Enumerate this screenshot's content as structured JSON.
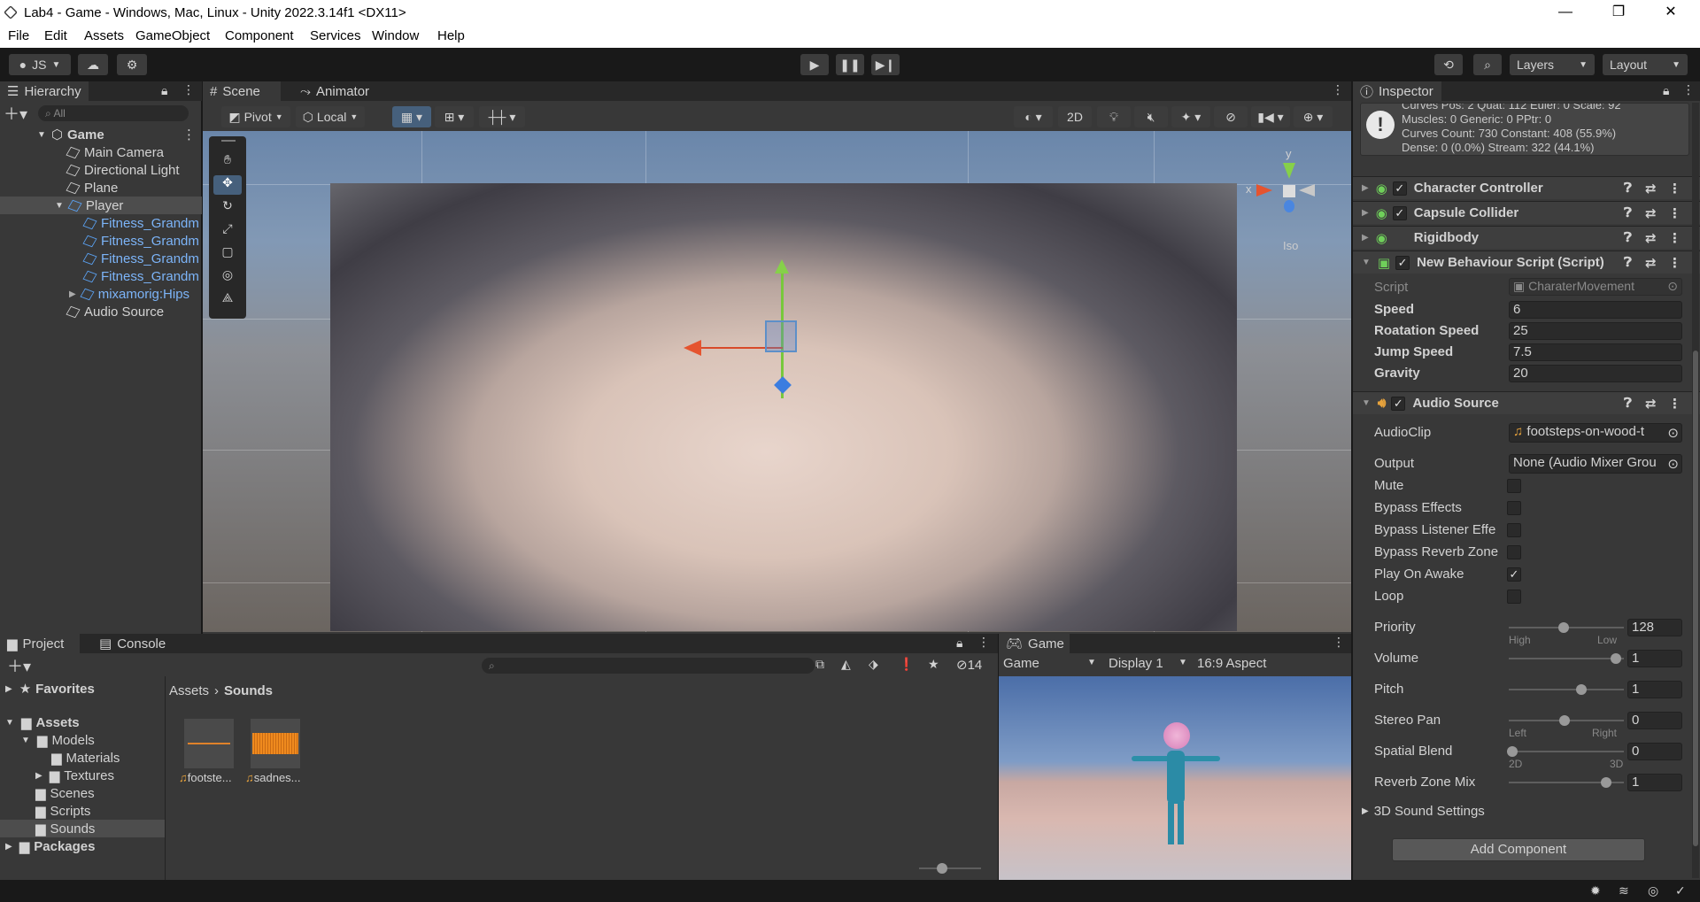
{
  "window": {
    "title": "Lab4 - Game - Windows, Mac, Linux - Unity 2022.3.14f1 <DX11>",
    "controls": [
      "—",
      "❐",
      "✕"
    ]
  },
  "menu": [
    "File",
    "Edit",
    "Assets",
    "GameObject",
    "Component",
    "Services",
    "Window",
    "Help"
  ],
  "toolbar": {
    "account": "JS",
    "layers": "Layers",
    "layout": "Layout"
  },
  "hierarchy": {
    "tab": "Hierarchy",
    "search_placeholder": "All",
    "root": "Game",
    "items": [
      {
        "label": "Main Camera"
      },
      {
        "label": "Directional Light"
      },
      {
        "label": "Plane"
      },
      {
        "label": "Player"
      },
      {
        "label": "Fitness_Grandm"
      },
      {
        "label": "Fitness_Grandm"
      },
      {
        "label": "Fitness_Grandm"
      },
      {
        "label": "Fitness_Grandm"
      },
      {
        "label": "mixamorig:Hips"
      },
      {
        "label": "Audio Source"
      }
    ]
  },
  "scene": {
    "tabs": [
      "Scene",
      "Animator"
    ],
    "pivot": "Pivot",
    "local": "Local",
    "toggle_2d": "2D",
    "gizmo": {
      "y": "y",
      "x": "x",
      "persp": "Iso"
    }
  },
  "project": {
    "tabs": [
      "Project",
      "Console"
    ],
    "hidden_count": "14",
    "breadcrumb": [
      "Assets",
      "Sounds"
    ],
    "tree": {
      "favorites": "Favorites",
      "assets": "Assets",
      "models": "Models",
      "materials": "Materials",
      "textures": "Textures",
      "scenes": "Scenes",
      "scripts": "Scripts",
      "sounds": "Sounds",
      "packages": "Packages"
    },
    "files": [
      "footste...",
      "sadnes..."
    ]
  },
  "game": {
    "tab": "Game",
    "mode": "Game",
    "display": "Display 1",
    "aspect": "16:9 Aspect"
  },
  "inspector": {
    "tab": "Inspector",
    "info_lines": [
      "Curves Pos: 2 Quat: 112 Euler: 0 Scale: 92",
      "Muscles: 0 Generic: 0 PPtr: 0",
      "Curves Count: 730 Constant: 408 (55.9%)",
      "Dense: 0 (0.0%) Stream: 322 (44.1%)"
    ],
    "components": [
      "Character Controller",
      "Capsule Collider",
      "Rigidbody",
      "New Behaviour Script (Script)",
      "Audio Source"
    ],
    "script": {
      "script_label": "Script",
      "script_value": "CharaterMovement",
      "speed_label": "Speed",
      "speed": "6",
      "rotation_label": "Roatation Speed",
      "rotation": "25",
      "jump_label": "Jump Speed",
      "jump": "7.5",
      "gravity_label": "Gravity",
      "gravity": "20"
    },
    "audio": {
      "clip_label": "AudioClip",
      "clip": "footsteps-on-wood-t",
      "output_label": "Output",
      "output": "None (Audio Mixer Grou",
      "mute": "Mute",
      "bypass_effects": "Bypass Effects",
      "bypass_listener": "Bypass Listener Effe",
      "bypass_reverb": "Bypass Reverb Zone",
      "play_on_awake": "Play On Awake",
      "loop": "Loop",
      "priority_label": "Priority",
      "priority": "128",
      "priority_min": "High",
      "priority_max": "Low",
      "volume_label": "Volume",
      "volume": "1",
      "pitch_label": "Pitch",
      "pitch": "1",
      "stereo_label": "Stereo Pan",
      "stereo": "0",
      "stereo_min": "Left",
      "stereo_max": "Right",
      "spatial_label": "Spatial Blend",
      "spatial": "0",
      "spatial_min": "2D",
      "spatial_max": "3D",
      "reverb_label": "Reverb Zone Mix",
      "reverb": "1",
      "settings_3d": "3D Sound Settings"
    },
    "add_component": "Add Component"
  },
  "colors": {
    "accent": "#3d74b8",
    "bg": "#383838",
    "dark": "#191919"
  }
}
